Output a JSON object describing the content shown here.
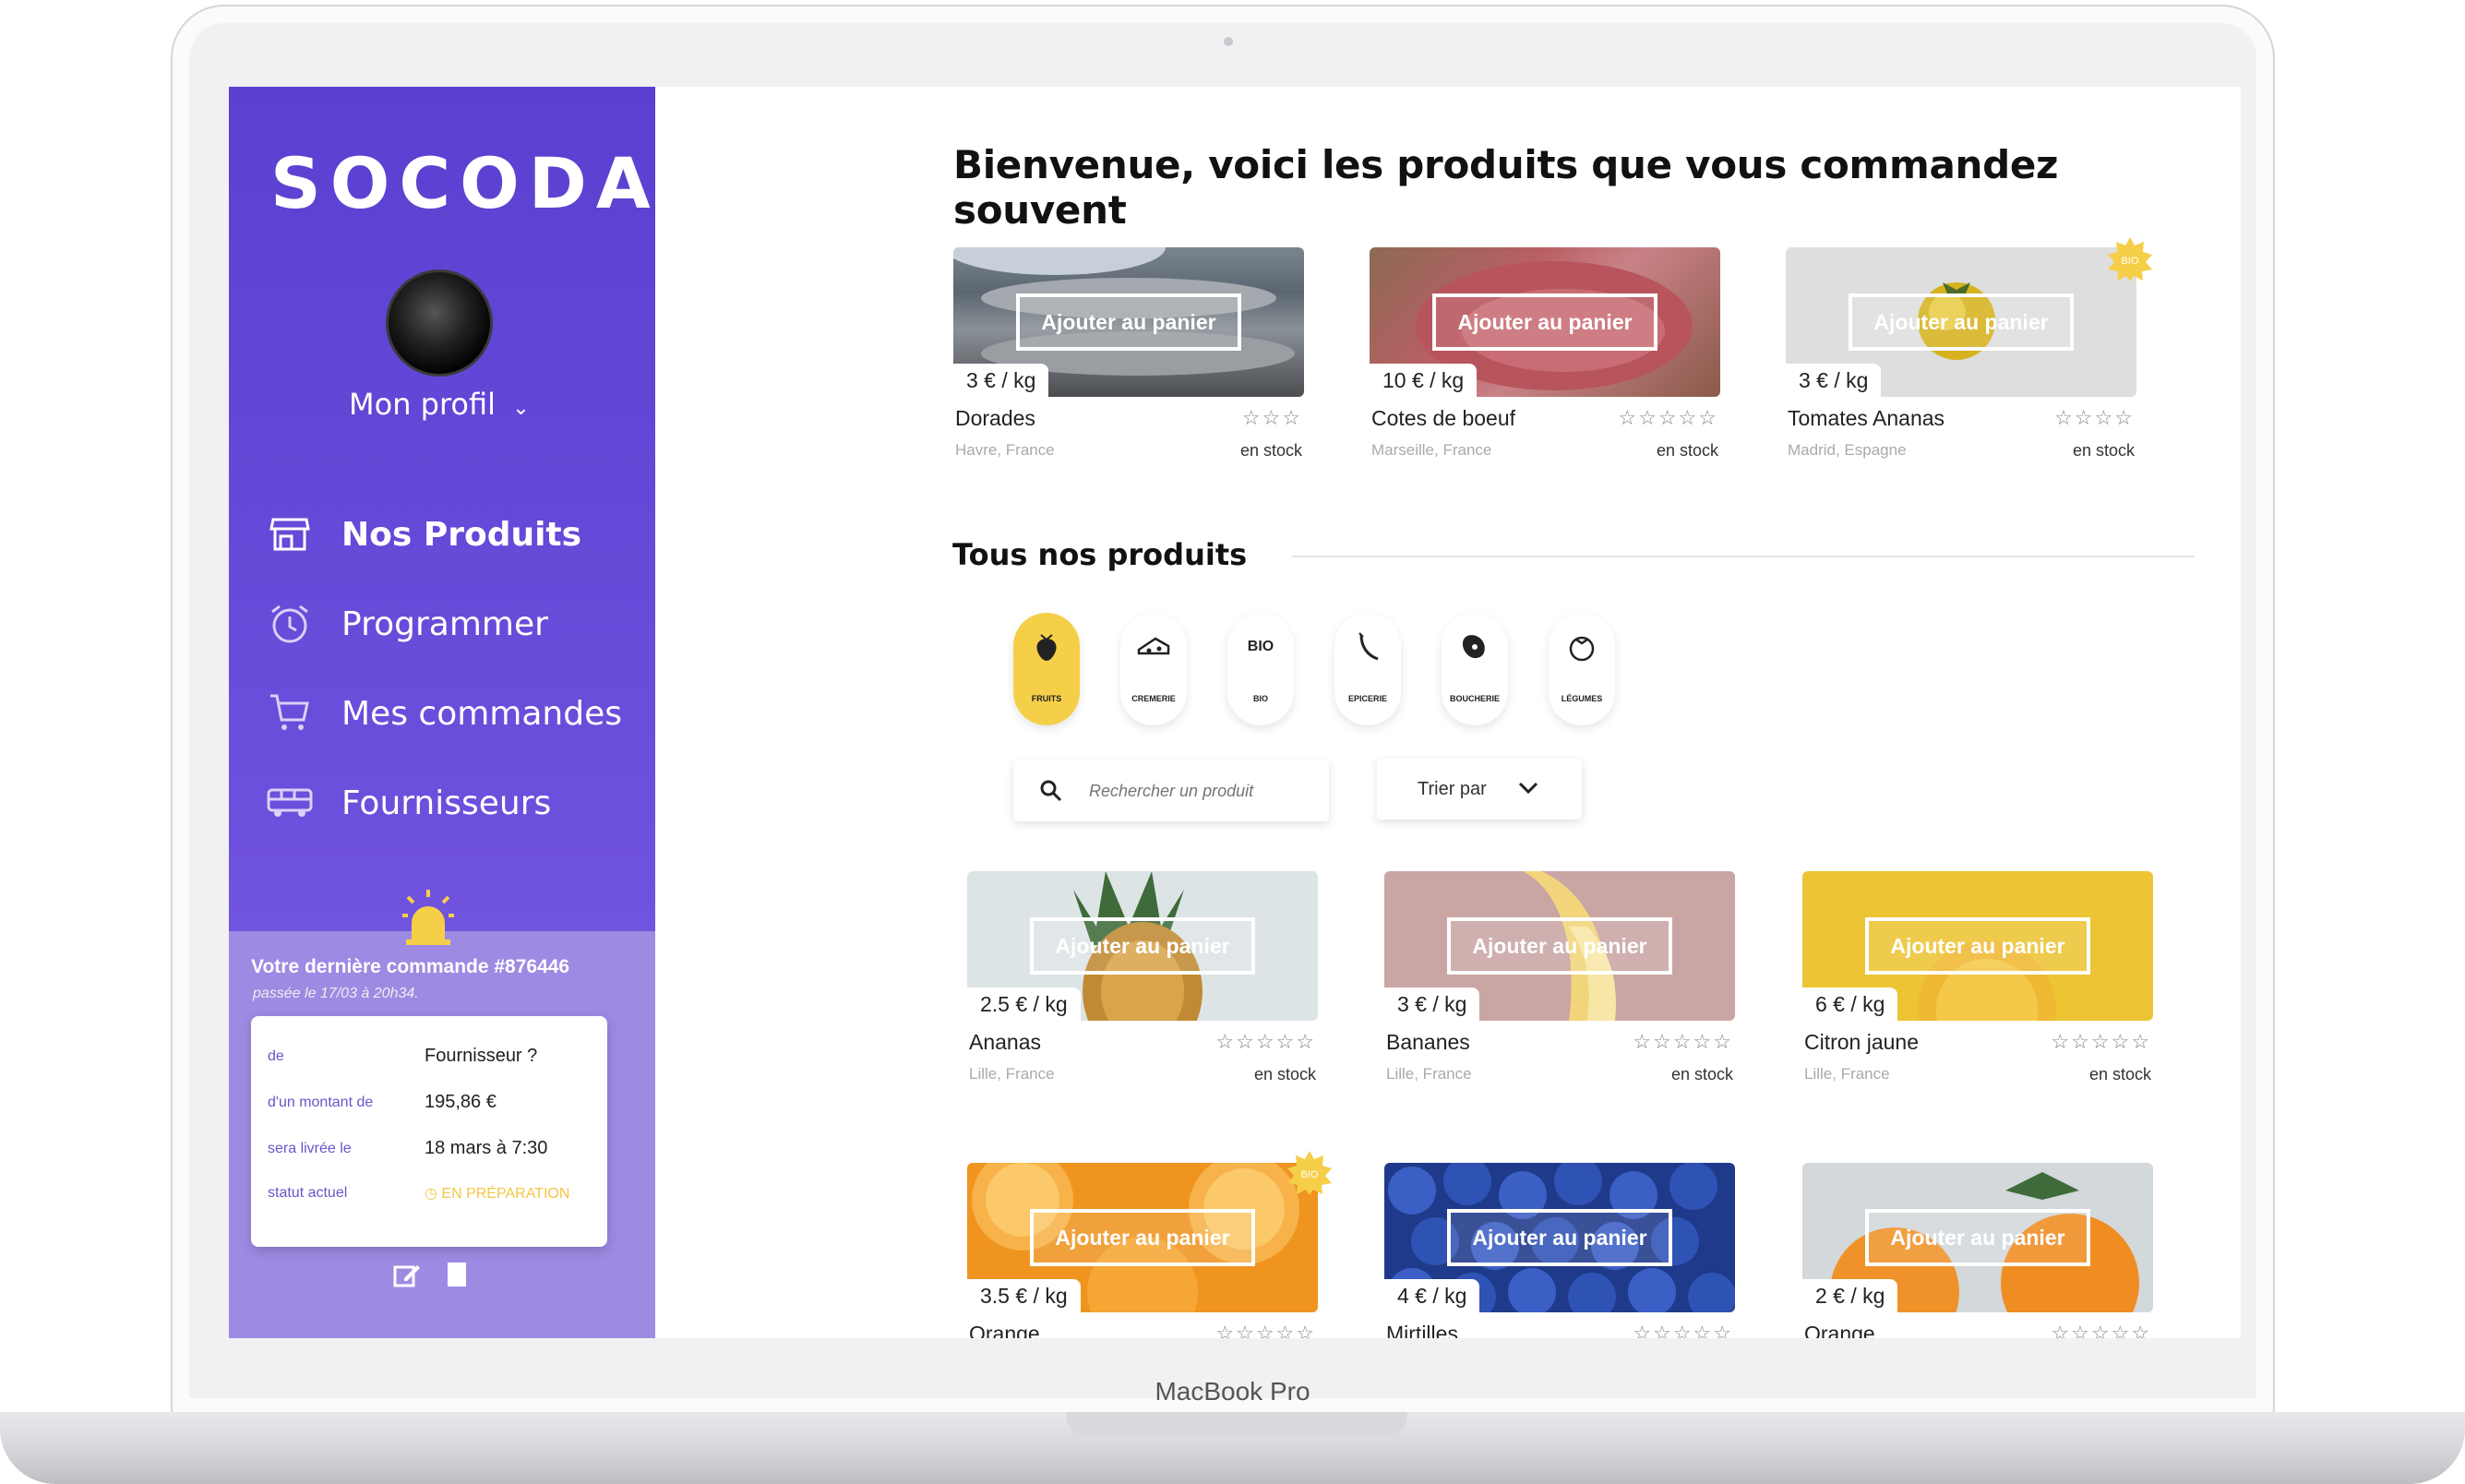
{
  "device": {
    "label": "MacBook Pro"
  },
  "sidebar": {
    "logo": "SOCODA",
    "profile_label": "Mon profil",
    "nav": [
      {
        "label": "Nos Produits",
        "icon": "store-icon",
        "active": true
      },
      {
        "label": "Programmer",
        "icon": "alarm-clock-icon"
      },
      {
        "label": "Mes commandes",
        "icon": "cart-icon"
      },
      {
        "label": "Fournisseurs",
        "icon": "truck-icon"
      }
    ],
    "last_order": {
      "title": "Votre dernière commande #876446",
      "subtitle": "passée le 17/03 à 20h34.",
      "rows": [
        {
          "key": "de",
          "value": "Fournisseur ?"
        },
        {
          "key": "d'un montant de",
          "value": "195,86 €"
        },
        {
          "key": "sera livrée le",
          "value": "18 mars à 7:30"
        },
        {
          "key": "statut actuel",
          "value": "EN PRÉPARATION"
        }
      ]
    }
  },
  "main": {
    "heading": "Bienvenue, voici les produits que vous commandez souvent",
    "add_to_cart": "Ajouter au panier",
    "frequent": [
      {
        "name": "Dorades",
        "price": "3 € / kg",
        "origin": "Havre, France",
        "stock": "en stock",
        "stars": "☆☆☆"
      },
      {
        "name": "Cotes de boeuf",
        "price": "10 € / kg",
        "origin": "Marseille, France",
        "stock": "en stock",
        "stars": "☆☆☆☆☆"
      },
      {
        "name": "Tomates Ananas",
        "price": "3 € / kg",
        "origin": "Madrid, Espagne",
        "stock": "en stock",
        "stars": "☆☆☆☆",
        "bio": "BIO"
      }
    ],
    "section_title": "Tous nos produits",
    "categories": [
      "FRUITS",
      "CREMERIE",
      "BIO",
      "EPICERIE",
      "BOUCHERIE",
      "LÉGUMES"
    ],
    "bio_icon_text": "BIO",
    "search": {
      "placeholder": "Rechercher un produit"
    },
    "sort_label": "Trier par",
    "products": [
      {
        "name": "Ananas",
        "price": "2.5 € / kg",
        "origin": "Lille, France",
        "stock": "en stock",
        "stars": "☆☆☆☆☆"
      },
      {
        "name": "Bananes",
        "price": "3 € / kg",
        "origin": "Lille, France",
        "stock": "en stock",
        "stars": "☆☆☆☆☆"
      },
      {
        "name": "Citron jaune",
        "price": "6 € / kg",
        "origin": "Lille, France",
        "stock": "en stock",
        "stars": "☆☆☆☆☆"
      },
      {
        "name": "Orange",
        "price": "3.5 € / kg",
        "stars": "☆☆☆☆☆",
        "bio": "BIO"
      },
      {
        "name": "Mirtilles",
        "price": "4 € / kg",
        "stars": "☆☆☆☆☆"
      },
      {
        "name": "Orange",
        "price": "2 € / kg",
        "stars": "☆☆☆☆☆"
      }
    ]
  }
}
